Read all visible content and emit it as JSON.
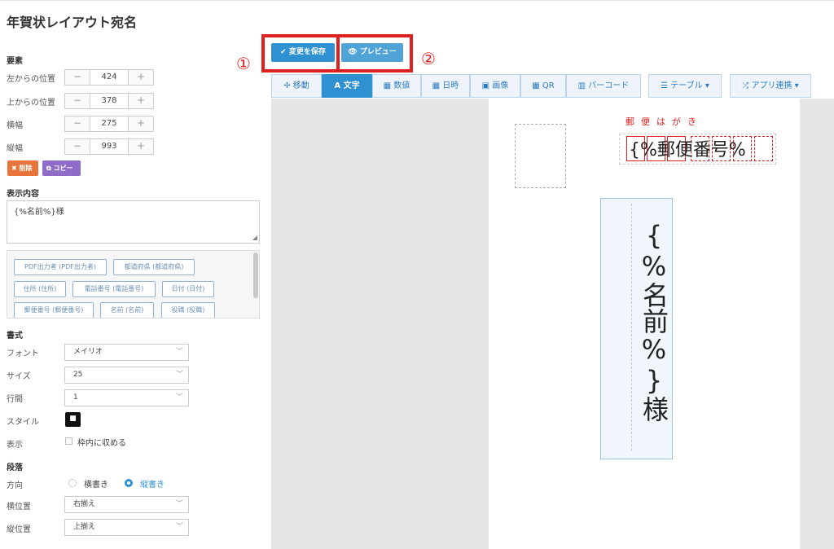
{
  "page_title": "年賀状レイアウト宛名",
  "sections": {
    "element": "要素",
    "content": "表示内容",
    "format": "書式",
    "paragraph": "段落"
  },
  "position": {
    "left_label": "左からの位置",
    "left_value": "424",
    "top_label": "上からの位置",
    "top_value": "378",
    "width_label": "横幅",
    "width_value": "275",
    "height_label": "縦幅",
    "height_value": "993",
    "minus": "−",
    "plus": "+"
  },
  "buttons": {
    "delete": "✖ 削除",
    "copy": "コピー"
  },
  "content_text": "{%名前%}様",
  "fields": [
    "PDF出力者 (PDF出力者)",
    "都道府県 (都道府県)",
    "住所 (住所)",
    "電話番号 (電話番号)",
    "日付 (日付)",
    "郵便番号 (郵便番号)",
    "名前 (名前)",
    "役職 (役職)"
  ],
  "format": {
    "font_label": "フォント",
    "font_value": "メイリオ",
    "size_label": "サイズ",
    "size_value": "25",
    "spacing_label": "行間",
    "spacing_value": "1",
    "style_label": "スタイル",
    "style_value": "■",
    "display_label": "表示",
    "fit_label": "枠内に収める"
  },
  "paragraph": {
    "direction_label": "方向",
    "horizontal": "横書き",
    "vertical": "縦書き",
    "h_align_label": "横位置",
    "h_align_value": "右揃え",
    "v_align_label": "縦位置",
    "v_align_value": "上揃え"
  },
  "toolbar": {
    "save": "✔ 変更を保存",
    "preview": "👁 プレビュー",
    "mark1": "①",
    "mark2": "②",
    "tools": [
      "✢ 移動",
      "A 文字",
      "▦ 数値",
      "▦ 日時",
      "▣ 画像",
      "▦ QR",
      "▥ バーコード",
      "☰ テーブル ▾",
      "⤮ アプリ連携 ▾"
    ]
  },
  "canvas": {
    "postal_label": "郵便はがき",
    "postal_text": "{%郵便番号%",
    "name_text": "{%名前%}様"
  },
  "colors": {
    "accent": "#2f91d1",
    "highlight": "#e0201e",
    "delete": "#e8743b",
    "copy": "#8e6cc8"
  }
}
